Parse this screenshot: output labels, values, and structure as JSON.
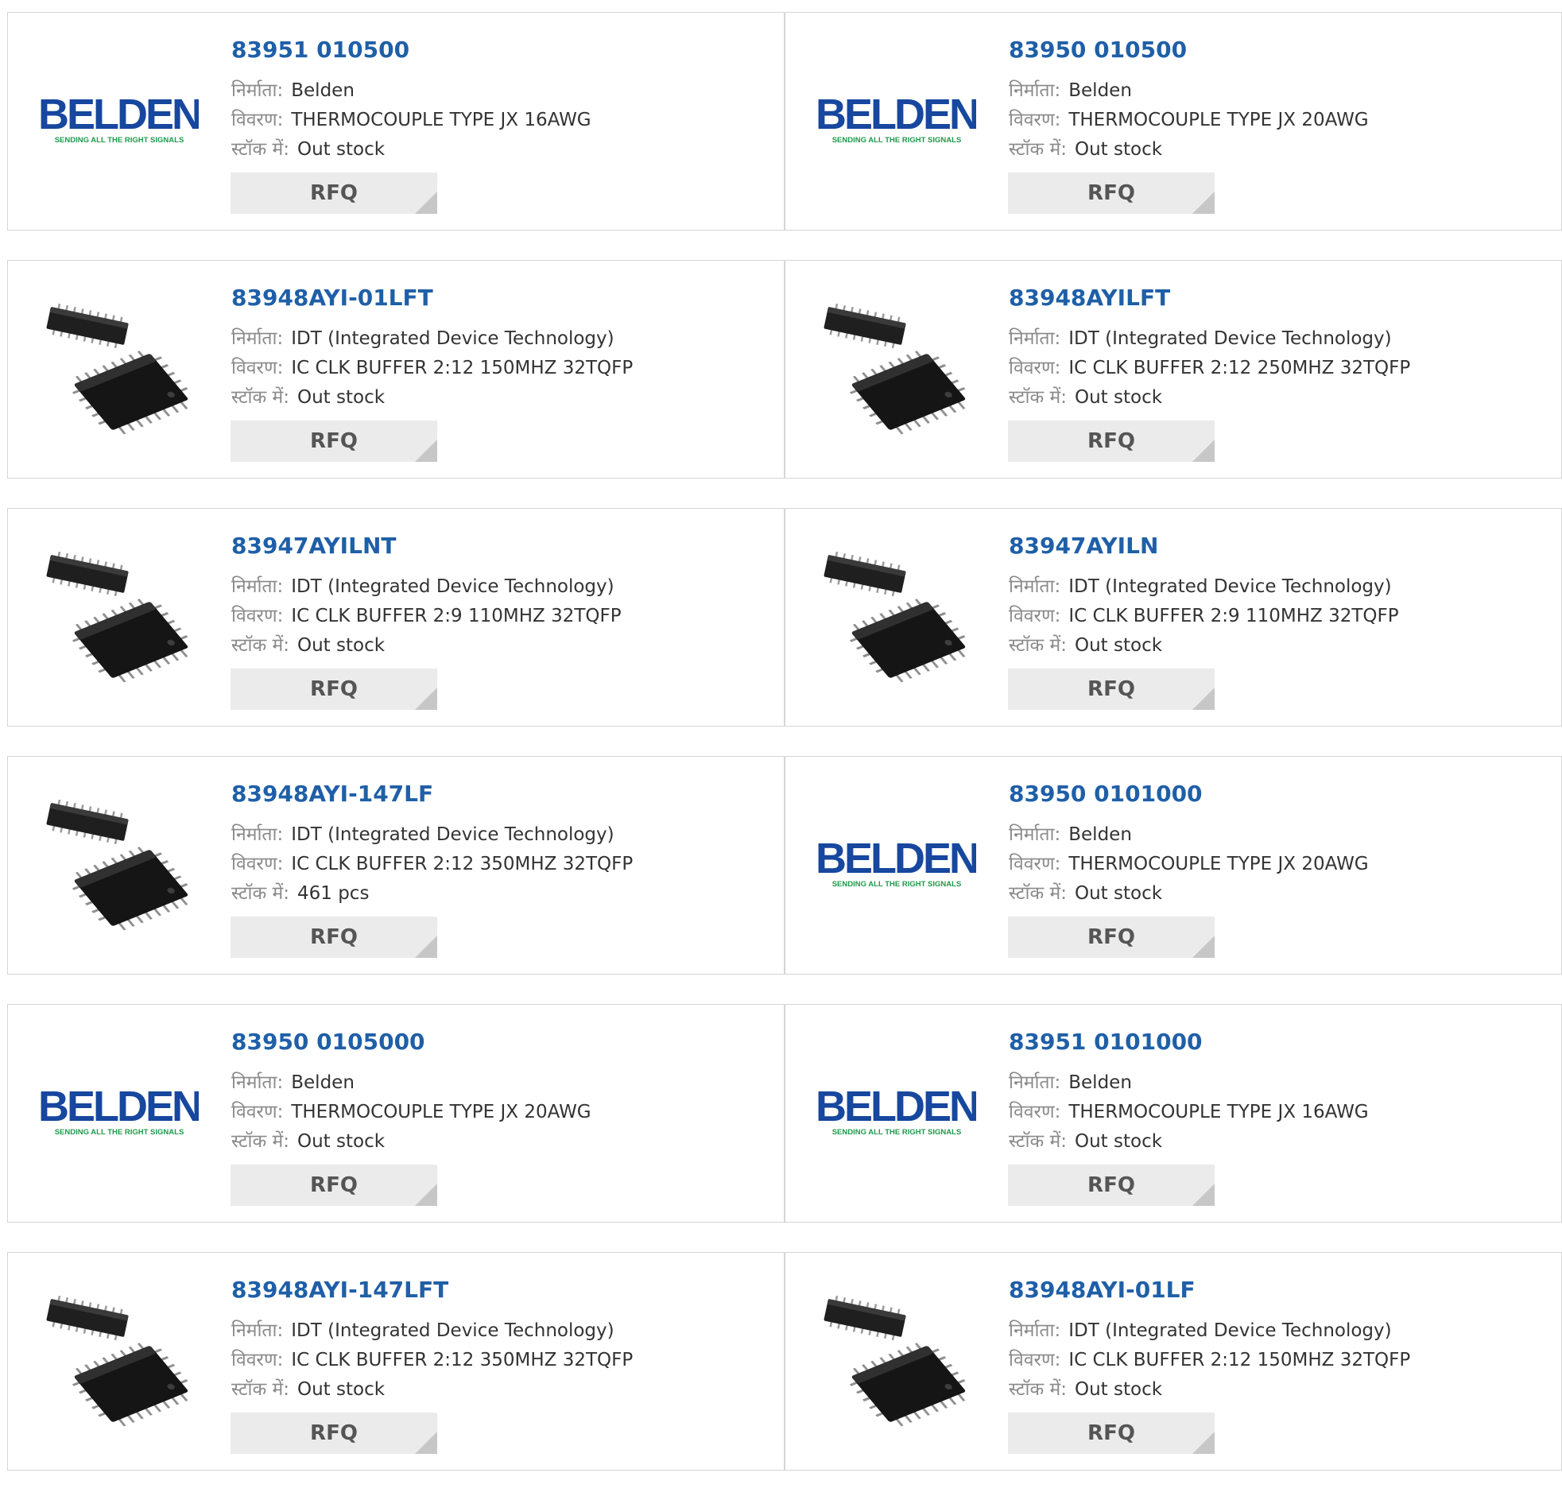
{
  "labels": {
    "manufacturer": "निर्माता:",
    "description": "विवरण:",
    "stock": "स्टॉक में:",
    "rfq": "RFQ"
  },
  "logo": {
    "name": "BELDEN",
    "tagline": "SENDING ALL THE RIGHT SIGNALS"
  },
  "colors": {
    "link": "#1f5fa7",
    "belden_blue": "#17479e",
    "belden_green": "#1d9a4a",
    "rfq_bg": "#ebebeb"
  },
  "products": [
    {
      "part": "83951 010500",
      "manufacturer": "Belden",
      "description": "THERMOCOUPLE TYPE JX 16AWG",
      "stock": "Out stock",
      "image": "belden-logo"
    },
    {
      "part": "83950 010500",
      "manufacturer": "Belden",
      "description": "THERMOCOUPLE TYPE JX 20AWG",
      "stock": "Out stock",
      "image": "belden-logo"
    },
    {
      "part": "83948AYI-01LFT",
      "manufacturer": "IDT (Integrated Device Technology)",
      "description": "IC CLK BUFFER 2:12 150MHZ 32TQFP",
      "stock": "Out stock",
      "image": "ic-chip-image"
    },
    {
      "part": "83948AYILFT",
      "manufacturer": "IDT (Integrated Device Technology)",
      "description": "IC CLK BUFFER 2:12 250MHZ 32TQFP",
      "stock": "Out stock",
      "image": "ic-chip-image"
    },
    {
      "part": "83947AYILNT",
      "manufacturer": "IDT (Integrated Device Technology)",
      "description": "IC CLK BUFFER 2:9 110MHZ 32TQFP",
      "stock": "Out stock",
      "image": "ic-chip-image"
    },
    {
      "part": "83947AYILN",
      "manufacturer": "IDT (Integrated Device Technology)",
      "description": "IC CLK BUFFER 2:9 110MHZ 32TQFP",
      "stock": "Out stock",
      "image": "ic-chip-image"
    },
    {
      "part": "83948AYI-147LF",
      "manufacturer": "IDT (Integrated Device Technology)",
      "description": "IC CLK BUFFER 2:12 350MHZ 32TQFP",
      "stock": "461 pcs",
      "image": "ic-chip-image"
    },
    {
      "part": "83950 0101000",
      "manufacturer": "Belden",
      "description": "THERMOCOUPLE TYPE JX 20AWG",
      "stock": "Out stock",
      "image": "belden-logo"
    },
    {
      "part": "83950 0105000",
      "manufacturer": "Belden",
      "description": "THERMOCOUPLE TYPE JX 20AWG",
      "stock": "Out stock",
      "image": "belden-logo"
    },
    {
      "part": "83951 0101000",
      "manufacturer": "Belden",
      "description": "THERMOCOUPLE TYPE JX 16AWG",
      "stock": "Out stock",
      "image": "belden-logo"
    },
    {
      "part": "83948AYI-147LFT",
      "manufacturer": "IDT (Integrated Device Technology)",
      "description": "IC CLK BUFFER 2:12 350MHZ 32TQFP",
      "stock": "Out stock",
      "image": "ic-chip-image"
    },
    {
      "part": "83948AYI-01LF",
      "manufacturer": "IDT (Integrated Device Technology)",
      "description": "IC CLK BUFFER 2:12 150MHZ 32TQFP",
      "stock": "Out stock",
      "image": "ic-chip-image"
    }
  ]
}
